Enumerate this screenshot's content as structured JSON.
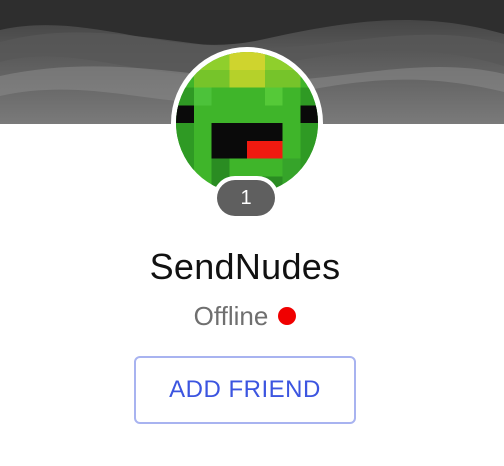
{
  "profile": {
    "username": "SendNudes",
    "level": "1",
    "status_text": "Offline",
    "status_color": "#f00000",
    "avatar_icon": "pixel-creeper-avatar-icon"
  },
  "actions": {
    "add_friend_label": "ADD FRIEND"
  },
  "colors": {
    "accent": "#3c55e0",
    "button_border": "#a8b3f0",
    "badge_bg": "#5f5f5f",
    "cover_bg": "#4a4a4a"
  }
}
